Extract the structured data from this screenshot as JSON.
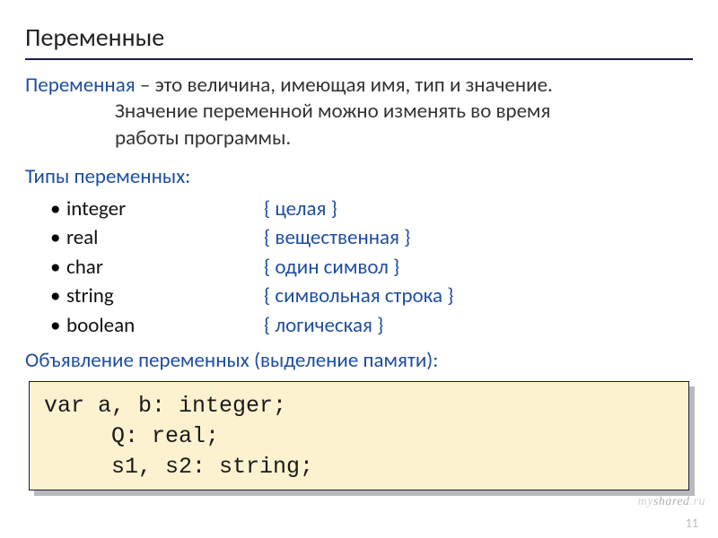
{
  "title": "Переменные",
  "definition": {
    "lead": "Переменная",
    "sep": " – ",
    "line1": "это величина, имеющая имя, тип и значение.",
    "line2": "Значение переменной можно изменять во время",
    "line3": "работы программы."
  },
  "types": {
    "heading": "Типы переменных:",
    "items": [
      {
        "name": "integer",
        "desc": "{ целая }"
      },
      {
        "name": "real",
        "desc": "{ вещественная }"
      },
      {
        "name": "char",
        "desc": "{ один символ }"
      },
      {
        "name": "string",
        "desc": "{ символьная строка }"
      },
      {
        "name": "boolean",
        "desc": "{ логическая }"
      }
    ]
  },
  "declaration": {
    "heading": "Объявление переменных (выделение памяти):",
    "code": {
      "l1": "var a, b: integer;",
      "l2": "Q: real;",
      "l3": "s1, s2: string;"
    }
  },
  "page_number": "11",
  "watermark": {
    "a": "my",
    "b": "shared",
    "c": ".ru"
  }
}
